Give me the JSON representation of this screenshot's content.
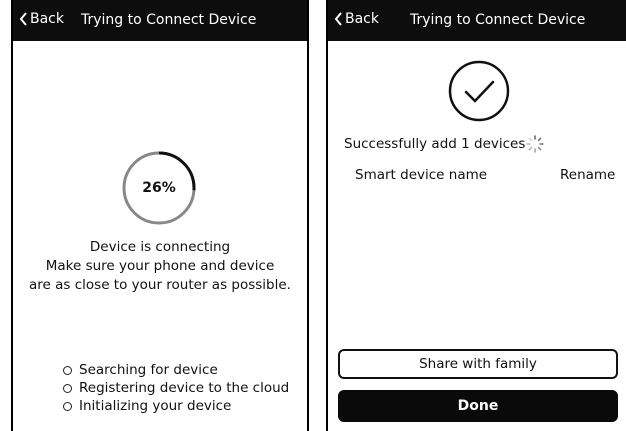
{
  "left_screen": {
    "header": {
      "back_label": "Back",
      "title": "Trying to Connect Device"
    },
    "progress": {
      "percent_label": "26%",
      "value": 0.26
    },
    "message": {
      "line1": "Device is connecting",
      "line2": "Make sure your phone and device",
      "line3": "are as close to your router as possible."
    },
    "steps": [
      {
        "label": "Searching for device"
      },
      {
        "label": "Registering device to the cloud"
      },
      {
        "label": "Initializing your device"
      }
    ]
  },
  "right_screen": {
    "header": {
      "back_label": "Back",
      "title": "Trying to Connect Device"
    },
    "success_text": "Successfully add 1 devices",
    "device_name_label": "Smart device name",
    "rename_label": "Rename",
    "share_button_label": "Share with family",
    "done_button_label": "Done"
  },
  "colors": {
    "header_bg": "#0d0d0d",
    "progress_track": "#888888",
    "progress_fill": "#111111"
  }
}
